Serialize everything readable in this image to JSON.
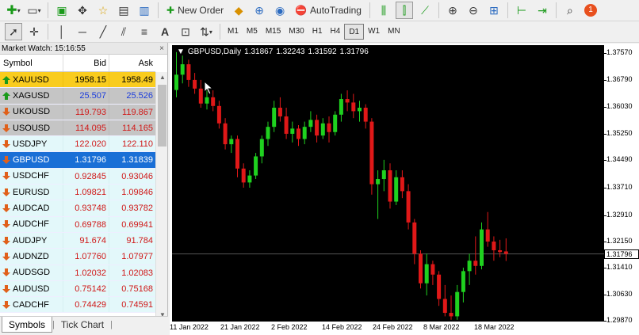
{
  "toolbar": {
    "new_order_label": "New Order",
    "autotrading_label": "AutoTrading",
    "notification_badge": "1",
    "timeframes": [
      "M1",
      "M5",
      "M15",
      "M30",
      "H1",
      "H4",
      "D1",
      "W1",
      "MN"
    ],
    "active_timeframe": "D1"
  },
  "market_watch": {
    "title": "Market Watch: 15:16:55",
    "close_glyph": "×",
    "columns": {
      "symbol": "Symbol",
      "bid": "Bid",
      "ask": "Ask"
    },
    "rows": [
      {
        "symbol": "XAUUSD",
        "bid": "1958.15",
        "ask": "1958.49",
        "direction": "up",
        "style": "gold"
      },
      {
        "symbol": "XAGUSD",
        "bid": "25.507",
        "ask": "25.526",
        "direction": "up",
        "style": "silver"
      },
      {
        "symbol": "UKOUSD",
        "bid": "119.793",
        "ask": "119.867",
        "direction": "down",
        "style": "oil"
      },
      {
        "symbol": "USOUSD",
        "bid": "114.095",
        "ask": "114.165",
        "direction": "down",
        "style": "oil"
      },
      {
        "symbol": "USDJPY",
        "bid": "122.020",
        "ask": "122.110",
        "direction": "down",
        "style": "normal"
      },
      {
        "symbol": "GBPUSD",
        "bid": "1.31796",
        "ask": "1.31839",
        "direction": "down",
        "style": "selected"
      },
      {
        "symbol": "USDCHF",
        "bid": "0.92845",
        "ask": "0.93046",
        "direction": "down",
        "style": "normal"
      },
      {
        "symbol": "EURUSD",
        "bid": "1.09821",
        "ask": "1.09846",
        "direction": "down",
        "style": "normal"
      },
      {
        "symbol": "AUDCAD",
        "bid": "0.93748",
        "ask": "0.93782",
        "direction": "down",
        "style": "normal"
      },
      {
        "symbol": "AUDCHF",
        "bid": "0.69788",
        "ask": "0.69941",
        "direction": "down",
        "style": "normal"
      },
      {
        "symbol": "AUDJPY",
        "bid": "91.674",
        "ask": "91.784",
        "direction": "down",
        "style": "normal"
      },
      {
        "symbol": "AUDNZD",
        "bid": "1.07760",
        "ask": "1.07977",
        "direction": "down",
        "style": "normal"
      },
      {
        "symbol": "AUDSGD",
        "bid": "1.02032",
        "ask": "1.02083",
        "direction": "down",
        "style": "normal"
      },
      {
        "symbol": "AUDUSD",
        "bid": "0.75142",
        "ask": "0.75168",
        "direction": "down",
        "style": "normal"
      },
      {
        "symbol": "CADCHF",
        "bid": "0.74429",
        "ask": "0.74591",
        "direction": "down",
        "style": "normal"
      }
    ],
    "tabs": [
      "Symbols",
      "Tick Chart"
    ],
    "active_tab": "Symbols"
  },
  "chart": {
    "symbol_label": "GBPUSD,Daily",
    "ohlc": [
      "1.31867",
      "1.32243",
      "1.31592",
      "1.31796"
    ],
    "current_price": "1.31796",
    "y_ticks": [
      "1.37570",
      "1.36790",
      "1.36030",
      "1.35250",
      "1.34490",
      "1.33710",
      "1.32910",
      "1.32150",
      "1.31410",
      "1.30630",
      "1.29870"
    ],
    "x_ticks": [
      "11 Jan 2022",
      "21 Jan 2022",
      "2 Feb 2022",
      "14 Feb 2022",
      "24 Feb 2022",
      "8 Mar 2022",
      "18 Mar 2022"
    ],
    "colors": {
      "bull": "#1fd11f",
      "bear": "#e01818",
      "background": "#000000"
    }
  },
  "chart_data": {
    "type": "candlestick",
    "series": [
      {
        "name": "GBPUSD,Daily",
        "candles": [
          [
            1.3651,
            1.376,
            1.363,
            1.3695
          ],
          [
            1.3695,
            1.375,
            1.367,
            1.3725
          ],
          [
            1.3725,
            1.3738,
            1.366,
            1.368
          ],
          [
            1.368,
            1.37,
            1.364,
            1.3655
          ],
          [
            1.3655,
            1.368,
            1.36,
            1.3612
          ],
          [
            1.3612,
            1.365,
            1.3595,
            1.363
          ],
          [
            1.363,
            1.365,
            1.359,
            1.3605
          ],
          [
            1.3605,
            1.362,
            1.354,
            1.3555
          ],
          [
            1.3555,
            1.357,
            1.348,
            1.3495
          ],
          [
            1.3495,
            1.352,
            1.347,
            1.351
          ],
          [
            1.351,
            1.352,
            1.34,
            1.3425
          ],
          [
            1.3425,
            1.344,
            1.337,
            1.3385
          ],
          [
            1.3385,
            1.342,
            1.337,
            1.3405
          ],
          [
            1.3405,
            1.347,
            1.3395,
            1.346
          ],
          [
            1.346,
            1.352,
            1.344,
            1.351
          ],
          [
            1.351,
            1.356,
            1.349,
            1.3545
          ],
          [
            1.3545,
            1.362,
            1.353,
            1.36
          ],
          [
            1.36,
            1.363,
            1.356,
            1.3575
          ],
          [
            1.3575,
            1.36,
            1.351,
            1.3525
          ],
          [
            1.3525,
            1.356,
            1.35,
            1.354
          ],
          [
            1.354,
            1.355,
            1.349,
            1.351
          ],
          [
            1.351,
            1.356,
            1.3495,
            1.3545
          ],
          [
            1.3545,
            1.359,
            1.353,
            1.3565
          ],
          [
            1.3565,
            1.358,
            1.35,
            1.352
          ],
          [
            1.352,
            1.357,
            1.351,
            1.3555
          ],
          [
            1.3555,
            1.3575,
            1.35,
            1.353
          ],
          [
            1.353,
            1.359,
            1.352,
            1.358
          ],
          [
            1.358,
            1.364,
            1.356,
            1.3625
          ],
          [
            1.3625,
            1.365,
            1.359,
            1.3615
          ],
          [
            1.3615,
            1.364,
            1.357,
            1.359
          ],
          [
            1.359,
            1.362,
            1.356,
            1.36
          ],
          [
            1.36,
            1.361,
            1.354,
            1.356
          ],
          [
            1.356,
            1.357,
            1.335,
            1.338
          ],
          [
            1.338,
            1.342,
            1.328,
            1.3395
          ],
          [
            1.3395,
            1.345,
            1.336,
            1.342
          ],
          [
            1.342,
            1.344,
            1.331,
            1.333
          ],
          [
            1.333,
            1.342,
            1.332,
            1.34
          ],
          [
            1.34,
            1.342,
            1.334,
            1.336
          ],
          [
            1.336,
            1.338,
            1.325,
            1.327
          ],
          [
            1.327,
            1.328,
            1.315,
            1.318
          ],
          [
            1.318,
            1.319,
            1.308,
            1.3095
          ],
          [
            1.3095,
            1.318,
            1.306,
            1.315
          ],
          [
            1.315,
            1.316,
            1.309,
            1.312
          ],
          [
            1.312,
            1.313,
            1.303,
            1.305
          ],
          [
            1.305,
            1.309,
            1.3,
            1.301
          ],
          [
            1.301,
            1.306,
            1.299,
            1.3
          ],
          [
            1.3,
            1.309,
            1.299,
            1.307
          ],
          [
            1.307,
            1.314,
            1.304,
            1.313
          ],
          [
            1.313,
            1.318,
            1.309,
            1.316
          ],
          [
            1.316,
            1.323,
            1.312,
            1.3145
          ],
          [
            1.3145,
            1.327,
            1.3135,
            1.325
          ],
          [
            1.325,
            1.33,
            1.32,
            1.3215
          ],
          [
            1.3215,
            1.323,
            1.316,
            1.319
          ],
          [
            1.319,
            1.322,
            1.317,
            1.3185
          ],
          [
            1.31867,
            1.32243,
            1.31592,
            1.31796
          ]
        ]
      }
    ],
    "x_labels": [
      "11 Jan 2022",
      "21 Jan 2022",
      "2 Feb 2022",
      "14 Feb 2022",
      "24 Feb 2022",
      "8 Mar 2022",
      "18 Mar 2022"
    ],
    "ylim": [
      1.2985,
      1.378
    ],
    "grid": false,
    "current_price_line": 1.31796
  }
}
